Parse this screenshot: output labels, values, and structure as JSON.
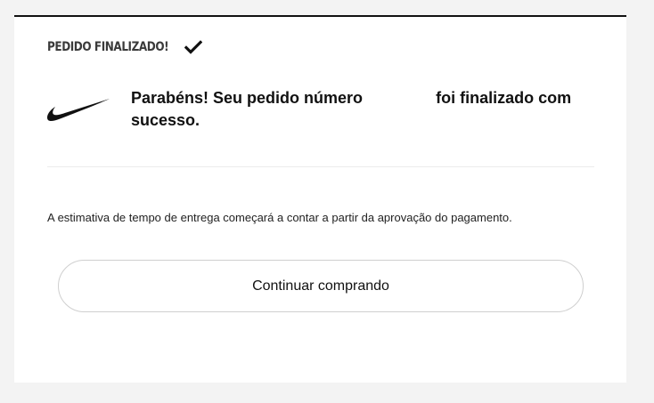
{
  "status": {
    "title": "PEDIDO FINALIZADO!",
    "icon": "check-icon"
  },
  "brand": {
    "logo": "nike-swoosh-logo"
  },
  "message": {
    "prefix": "Parabéns! Seu pedido número",
    "order_number": "",
    "suffix": "foi finalizado com sucesso."
  },
  "info": {
    "estimate": "A estimativa de tempo de entrega começará a contar a partir da aprovação do pagamento."
  },
  "actions": {
    "continue_label": "Continuar comprando"
  },
  "colors": {
    "background": "#f3f3f3",
    "card": "#ffffff",
    "text": "#111111",
    "border": "#cfcfcf"
  }
}
